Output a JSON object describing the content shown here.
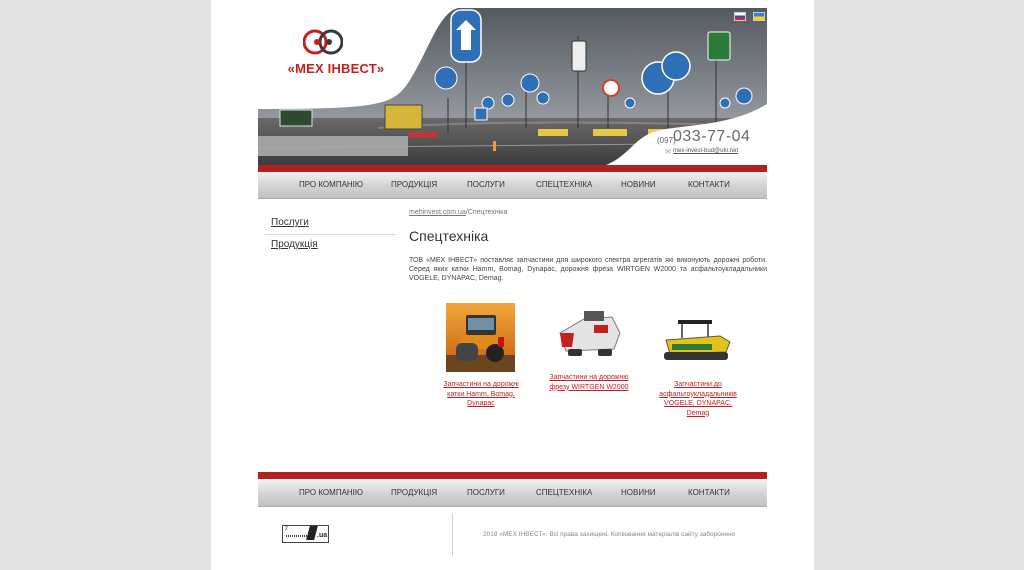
{
  "header": {
    "logo_text": "«МЕХ ІНВЕСТ»",
    "phone_code": "(097)",
    "phone": "033-77-04",
    "email": "mex-invest-bud@ukr.net",
    "languages": [
      "ru",
      "ua"
    ]
  },
  "nav": [
    "ПРО КОМПАНІЮ",
    "ПРОДУКЦІЯ",
    "ПОСЛУГИ",
    "СПЕЦТЕХНІКА",
    "НОВИНИ",
    "КОНТАКТИ"
  ],
  "sidebar": [
    "Послуги",
    "Продукція"
  ],
  "breadcrumb": {
    "home": "mehinvest.com.ua",
    "separator": "/",
    "current": "Спецтехніка"
  },
  "page_title": "Спецтехніка",
  "intro": "ТОВ «МЕХ ІНВЕСТ» поставляє запчастини для широкого спектра агрегатів які виконують дорожні роботи. Серед яких катки Hamm, Bomag, Dynapac, дорожня фреза WIRTGEN W2000 та асфальтоукладальники VOGELE, DYNAPAC, Demag.",
  "products": [
    {
      "lines": [
        "Запчастини на дорожні",
        "катки Hamm, Bomag,",
        "Dynapac"
      ],
      "image": "road-roller"
    },
    {
      "lines": [
        "Запчастини на дорожню",
        "фрезу WIRTGEN W2000"
      ],
      "image": "road-milling-machine"
    },
    {
      "lines": [
        "Запчастини до",
        "асфальтоукладальників",
        "VOGELE, DYNAPAC,",
        "Demag"
      ],
      "image": "asphalt-paver"
    }
  ],
  "footer": {
    "counter_top": "2",
    "counter_domain": ".ua",
    "copyright": "2018 «МЕХ ІНВЕСТ». Всі права захищені. Копіювання матеріалів сайту заборонено"
  },
  "colors": {
    "brand_red": "#c61f1f",
    "bar_red": "#b22020",
    "link_red": "#c51e1e"
  }
}
